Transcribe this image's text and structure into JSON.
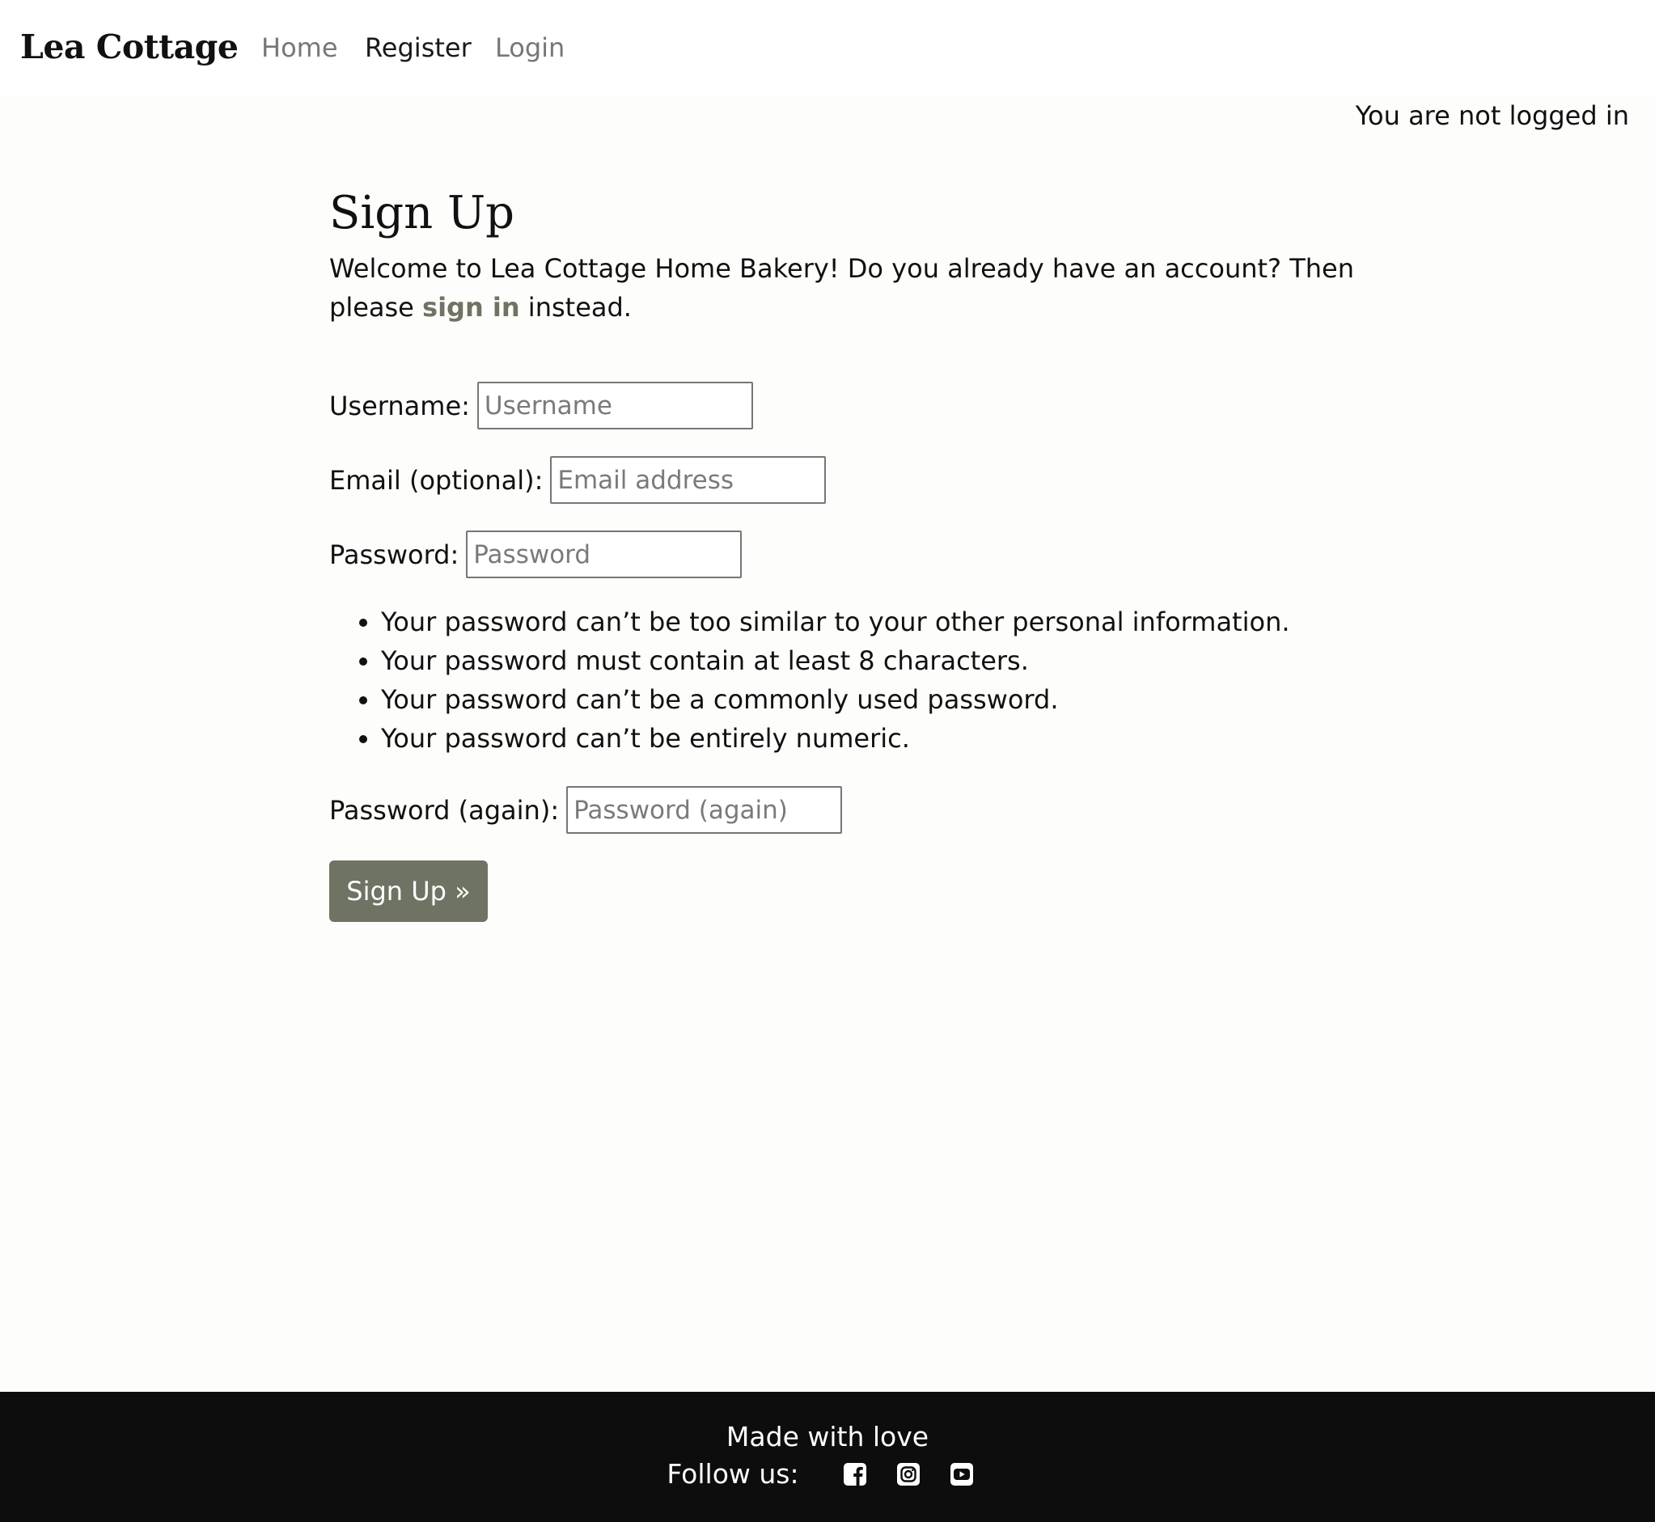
{
  "nav": {
    "brand": "Lea Cottage",
    "links": [
      {
        "label": "Home"
      },
      {
        "label": "Register"
      },
      {
        "label": "Login"
      }
    ]
  },
  "status": "You are not logged in",
  "signup": {
    "title": "Sign Up",
    "intro_before": "Welcome to Lea Cottage Home Bakery! Do you already have an account? Then please ",
    "intro_link": "sign in",
    "intro_after": " instead.",
    "fields": {
      "username": {
        "label": "Username:",
        "placeholder": "Username"
      },
      "email": {
        "label": "Email (optional):",
        "placeholder": "Email address"
      },
      "password": {
        "label": "Password:",
        "placeholder": "Password"
      },
      "password2": {
        "label": "Password (again):",
        "placeholder": "Password (again)"
      }
    },
    "help": [
      "Your password can’t be too similar to your other personal information.",
      "Your password must contain at least 8 characters.",
      "Your password can’t be a commonly used password.",
      "Your password can’t be entirely numeric."
    ],
    "submit_label": "Sign Up »"
  },
  "footer": {
    "tagline": "Made with love",
    "follow_label": "Follow us:",
    "social_icons": [
      "facebook-icon",
      "instagram-icon",
      "youtube-icon"
    ]
  },
  "colors": {
    "accent": "#6f7363",
    "footer_bg": "#0c0d0c",
    "page_bg": "#fdfdfb"
  }
}
